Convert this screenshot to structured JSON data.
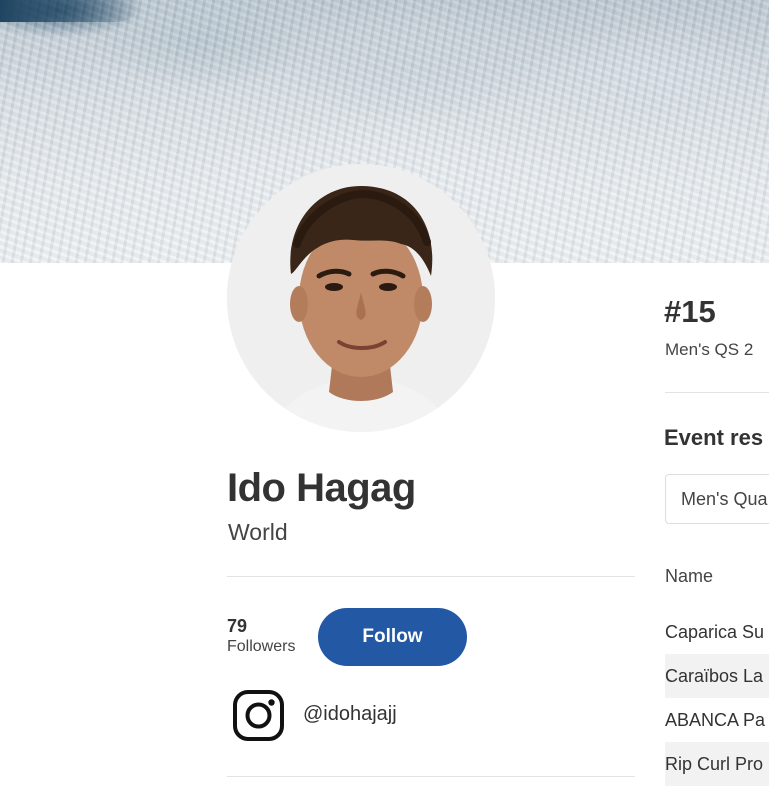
{
  "profile": {
    "name": "Ido Hagag",
    "country": "World",
    "followers_count": "79",
    "followers_label": "Followers",
    "follow_label": "Follow",
    "instagram_handle": "@idohajajj"
  },
  "ranking": {
    "rank": "#15",
    "tour": "Men's QS 2"
  },
  "event_results": {
    "title": "Event res",
    "filter_selected": "Men's Qua",
    "column_header": "Name",
    "rows": [
      {
        "name": "Caparica Su"
      },
      {
        "name": "Caraïbos La"
      },
      {
        "name": "ABANCA Pa"
      },
      {
        "name": "Rip Curl Pro"
      }
    ]
  },
  "colors": {
    "accent": "#2358a4",
    "row_alt": "#f2f2f2"
  },
  "icons": {
    "instagram": "instagram-icon"
  }
}
